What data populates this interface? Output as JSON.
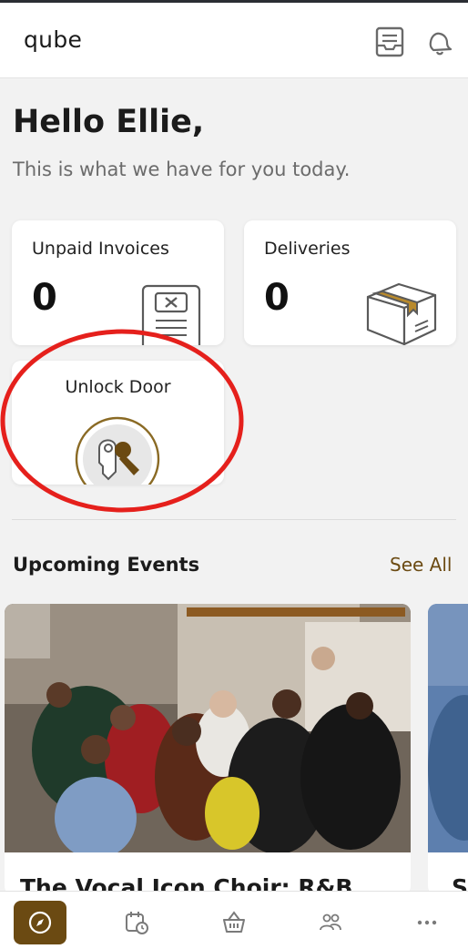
{
  "app": {
    "logo": "qube"
  },
  "header": {
    "inbox_icon": "inbox-icon",
    "bell_icon": "bell-icon"
  },
  "greeting": {
    "title": "Hello Ellie,",
    "subtitle": "This is what we have for you today."
  },
  "cards": {
    "invoices": {
      "label": "Unpaid Invoices",
      "count": "0",
      "icon": "invoice-icon"
    },
    "deliveries": {
      "label": "Deliveries",
      "count": "0",
      "icon": "package-icon"
    },
    "unlock": {
      "label": "Unlock Door",
      "icon": "key-icon"
    }
  },
  "events": {
    "section_title": "Upcoming Events",
    "see_all": "See All",
    "items": [
      {
        "title": "The Vocal Icon Choir: R&B"
      },
      {
        "title": "S"
      }
    ]
  },
  "tabs": [
    {
      "name": "discover",
      "icon": "compass-icon",
      "active": true
    },
    {
      "name": "bookings",
      "icon": "calendar-icon",
      "active": false
    },
    {
      "name": "shop",
      "icon": "basket-icon",
      "active": false
    },
    {
      "name": "community",
      "icon": "people-icon",
      "active": false
    },
    {
      "name": "more",
      "icon": "more-icon",
      "active": false
    }
  ],
  "colors": {
    "accent": "#6b4a12",
    "annotation": "#e5201c",
    "background": "#f2f2f2"
  }
}
